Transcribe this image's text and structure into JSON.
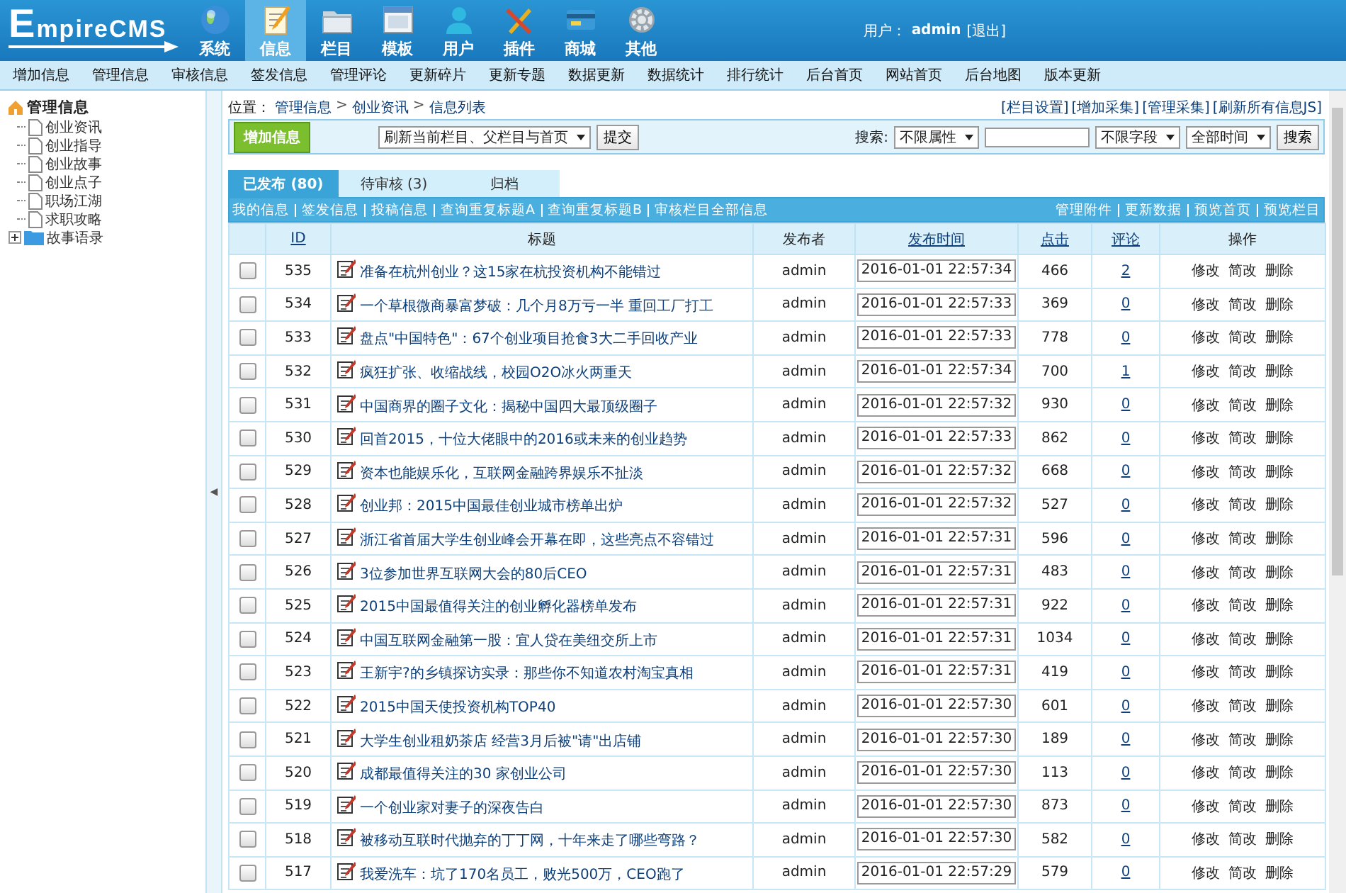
{
  "logo": "EmpireCMS",
  "nav": [
    {
      "label": "系统",
      "selected": false
    },
    {
      "label": "信息",
      "selected": true
    },
    {
      "label": "栏目",
      "selected": false
    },
    {
      "label": "模板",
      "selected": false
    },
    {
      "label": "用户",
      "selected": false
    },
    {
      "label": "插件",
      "selected": false
    },
    {
      "label": "商城",
      "selected": false
    },
    {
      "label": "其他",
      "selected": false
    }
  ],
  "user": {
    "label": "用户：",
    "name": "admin",
    "logout": "[退出]"
  },
  "menu": [
    "增加信息",
    "管理信息",
    "审核信息",
    "签发信息",
    "管理评论",
    "更新碎片",
    "更新专题",
    "数据更新",
    "数据统计",
    "排行统计",
    "后台首页",
    "网站首页",
    "后台地图",
    "版本更新"
  ],
  "sidebar": {
    "root": "管理信息",
    "items": [
      {
        "label": "创业资讯",
        "kind": "page"
      },
      {
        "label": "创业指导",
        "kind": "page"
      },
      {
        "label": "创业故事",
        "kind": "page"
      },
      {
        "label": "创业点子",
        "kind": "page"
      },
      {
        "label": "职场江湖",
        "kind": "page"
      },
      {
        "label": "求职攻略",
        "kind": "page"
      },
      {
        "label": "故事语录",
        "kind": "folder",
        "expanded": false
      }
    ],
    "collapse": "◀"
  },
  "breadcrumb": {
    "label": "位置：",
    "parts": [
      "管理信息",
      "创业资讯",
      "信息列表"
    ],
    "sep": ">"
  },
  "top_links": [
    "[栏目设置]",
    "[增加采集]",
    "[管理采集]",
    "[刷新所有信息JS]"
  ],
  "toolbar": {
    "add": "增加信息",
    "refresh": "刷新当前栏目、父栏目与首页",
    "submit": "提交",
    "search_label": "搜索:",
    "attr": "不限属性",
    "field": "不限字段",
    "time": "全部时间",
    "search": "搜索"
  },
  "tabs": [
    {
      "label": "已发布 (80)",
      "selected": true
    },
    {
      "label": "待审核 (3)",
      "selected": false
    },
    {
      "label": "归档",
      "selected": false
    }
  ],
  "links_left": [
    "我的信息",
    "签发信息",
    "投稿信息",
    "查询重复标题A",
    "查询重复标题B",
    "审核栏目全部信息"
  ],
  "links_right": [
    "管理附件",
    "更新数据",
    "预览首页",
    "预览栏目"
  ],
  "columns": [
    "ID",
    "标题",
    "发布者",
    "发布时间",
    "点击",
    "评论",
    "操作"
  ],
  "rows": [
    {
      "id": "535",
      "title": "准备在杭州创业？这15家在杭投资机构不能错过",
      "author": "admin",
      "time": "2016-01-01 22:57:34",
      "clicks": "466",
      "comments": "2",
      "ops": [
        "修改",
        "简改",
        "删除"
      ],
      "checked": false
    },
    {
      "id": "534",
      "title": "一个草根微商暴富梦破：几个月8万亏一半 重回工厂打工",
      "author": "admin",
      "time": "2016-01-01 22:57:33",
      "clicks": "369",
      "comments": "0",
      "ops": [
        "修改",
        "简改",
        "删除"
      ],
      "checked": false
    },
    {
      "id": "533",
      "title": "盘点\"中国特色\"：67个创业项目抢食3大二手回收产业",
      "author": "admin",
      "time": "2016-01-01 22:57:33",
      "clicks": "778",
      "comments": "0",
      "ops": [
        "修改",
        "简改",
        "删除"
      ],
      "checked": false
    },
    {
      "id": "532",
      "title": "疯狂扩张、收缩战线，校园O2O冰火两重天",
      "author": "admin",
      "time": "2016-01-01 22:57:34",
      "clicks": "700",
      "comments": "1",
      "ops": [
        "修改",
        "简改",
        "删除"
      ],
      "checked": false
    },
    {
      "id": "531",
      "title": "中国商界的圈子文化：揭秘中国四大最顶级圈子",
      "author": "admin",
      "time": "2016-01-01 22:57:32",
      "clicks": "930",
      "comments": "0",
      "ops": [
        "修改",
        "简改",
        "删除"
      ],
      "checked": false
    },
    {
      "id": "530",
      "title": "回首2015，十位大佬眼中的2016或未来的创业趋势",
      "author": "admin",
      "time": "2016-01-01 22:57:33",
      "clicks": "862",
      "comments": "0",
      "ops": [
        "修改",
        "简改",
        "删除"
      ],
      "checked": false
    },
    {
      "id": "529",
      "title": "资本也能娱乐化，互联网金融跨界娱乐不扯淡",
      "author": "admin",
      "time": "2016-01-01 22:57:32",
      "clicks": "668",
      "comments": "0",
      "ops": [
        "修改",
        "简改",
        "删除"
      ],
      "checked": false
    },
    {
      "id": "528",
      "title": "创业邦：2015中国最佳创业城市榜单出炉",
      "author": "admin",
      "time": "2016-01-01 22:57:32",
      "clicks": "527",
      "comments": "0",
      "ops": [
        "修改",
        "简改",
        "删除"
      ],
      "checked": false
    },
    {
      "id": "527",
      "title": "浙江省首届大学生创业峰会开幕在即，这些亮点不容错过",
      "author": "admin",
      "time": "2016-01-01 22:57:31",
      "clicks": "596",
      "comments": "0",
      "ops": [
        "修改",
        "简改",
        "删除"
      ],
      "checked": false
    },
    {
      "id": "526",
      "title": "3位参加世界互联网大会的80后CEO",
      "author": "admin",
      "time": "2016-01-01 22:57:31",
      "clicks": "483",
      "comments": "0",
      "ops": [
        "修改",
        "简改",
        "删除"
      ],
      "checked": false
    },
    {
      "id": "525",
      "title": "2015中国最值得关注的创业孵化器榜单发布",
      "author": "admin",
      "time": "2016-01-01 22:57:31",
      "clicks": "922",
      "comments": "0",
      "ops": [
        "修改",
        "简改",
        "删除"
      ],
      "checked": false
    },
    {
      "id": "524",
      "title": "中国互联网金融第一股：宜人贷在美纽交所上市",
      "author": "admin",
      "time": "2016-01-01 22:57:31",
      "clicks": "1034",
      "comments": "0",
      "ops": [
        "修改",
        "简改",
        "删除"
      ],
      "checked": false
    },
    {
      "id": "523",
      "title": "王新宇?的乡镇探访实录：那些你不知道农村淘宝真相",
      "author": "admin",
      "time": "2016-01-01 22:57:31",
      "clicks": "419",
      "comments": "0",
      "ops": [
        "修改",
        "简改",
        "删除"
      ],
      "checked": false
    },
    {
      "id": "522",
      "title": "2015中国天使投资机构TOP40",
      "author": "admin",
      "time": "2016-01-01 22:57:30",
      "clicks": "601",
      "comments": "0",
      "ops": [
        "修改",
        "简改",
        "删除"
      ],
      "checked": false
    },
    {
      "id": "521",
      "title": "大学生创业租奶茶店 经营3月后被\"请\"出店铺",
      "author": "admin",
      "time": "2016-01-01 22:57:30",
      "clicks": "189",
      "comments": "0",
      "ops": [
        "修改",
        "简改",
        "删除"
      ],
      "checked": false
    },
    {
      "id": "520",
      "title": "成都最值得关注的30 家创业公司",
      "author": "admin",
      "time": "2016-01-01 22:57:30",
      "clicks": "113",
      "comments": "0",
      "ops": [
        "修改",
        "简改",
        "删除"
      ],
      "checked": false
    },
    {
      "id": "519",
      "title": "一个创业家对妻子的深夜告白",
      "author": "admin",
      "time": "2016-01-01 22:57:30",
      "clicks": "873",
      "comments": "0",
      "ops": [
        "修改",
        "简改",
        "删除"
      ],
      "checked": false
    },
    {
      "id": "518",
      "title": "被移动互联时代抛弃的丁丁网，十年来走了哪些弯路？",
      "author": "admin",
      "time": "2016-01-01 22:57:30",
      "clicks": "582",
      "comments": "0",
      "ops": [
        "修改",
        "简改",
        "删除"
      ],
      "checked": false
    },
    {
      "id": "517",
      "title": "我爱洗车：坑了170名员工，败光500万，CEO跑了",
      "author": "admin",
      "time": "2016-01-01 22:57:29",
      "clicks": "579",
      "comments": "0",
      "ops": [
        "修改",
        "简改",
        "删除"
      ],
      "checked": false
    }
  ]
}
